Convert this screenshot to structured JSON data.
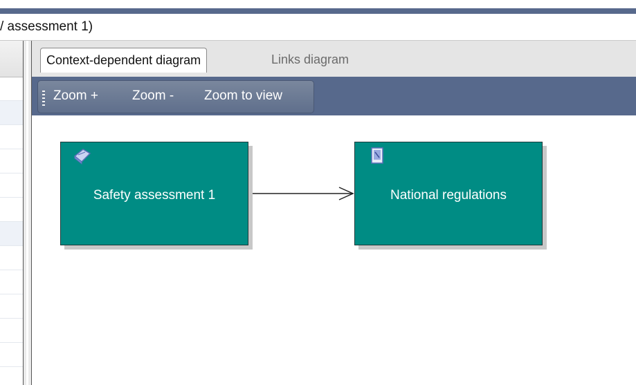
{
  "window": {
    "title": "/ assessment 1)"
  },
  "tabs": [
    {
      "label": "Context-dependent diagram",
      "active": true
    },
    {
      "label": "Links diagram",
      "active": false
    }
  ],
  "toolbar": {
    "zoom_in": "Zoom +",
    "zoom_out": "Zoom -",
    "zoom_to_view": "Zoom to view"
  },
  "diagram": {
    "nodes": [
      {
        "label": "Safety assessment 1",
        "icon": "assessment-book-icon"
      },
      {
        "label": "National regulations",
        "icon": "regulation-document-icon"
      }
    ],
    "edge": {
      "from": "Safety assessment 1",
      "to": "National regulations"
    }
  },
  "colors": {
    "node_fill": "#008c84",
    "toolbar_bg": "#57698c",
    "node_text": "#ffffff"
  }
}
